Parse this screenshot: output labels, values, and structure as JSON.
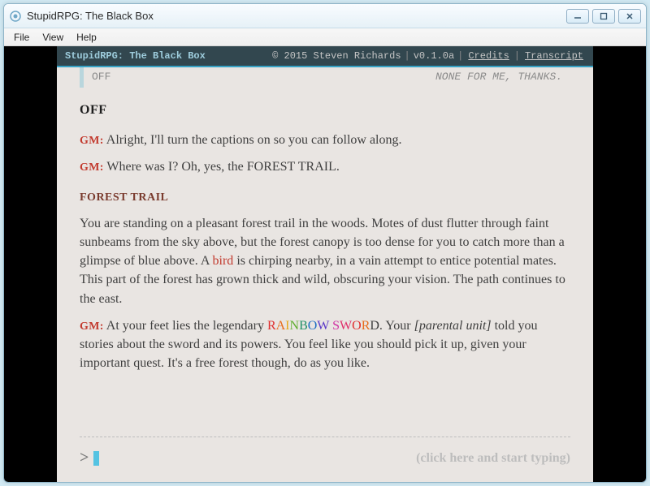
{
  "window": {
    "title": "StupidRPG: The Black Box",
    "menu": {
      "file": "File",
      "view": "View",
      "help": "Help"
    }
  },
  "gamebar": {
    "title": "StupidRPG: The Black Box",
    "copyright": "© 2015 Steven Richards",
    "version": "v0.1.0a",
    "credits": "Credits",
    "transcript": "Transcript"
  },
  "prev": {
    "left": "OFF",
    "right": "NONE FOR ME, THANKS."
  },
  "cmd": "OFF",
  "gm_label": "GM:",
  "gm1": " Alright, I'll turn the captions on so you can follow along.",
  "gm2": " Where was I? Oh, yes, the FOREST TRAIL.",
  "location": "FOREST TRAIL",
  "desc_a": "You are standing on a pleasant forest trail in the woods. Motes of dust flutter through faint sunbeams from the sky above, but the forest canopy is too dense for you to catch more than a glimpse of blue above. A ",
  "bird": "bird",
  "desc_b": " is chirping nearby, in a vain attempt to entice potential mates. This part of the forest has grown thick and wild, obscuring your vision. The path continues to the east.",
  "gm3_a": " At your feet lies the legendary ",
  "rainbow": "RAINBOW SWORD",
  "gm3_b": ". Your ",
  "parental": "[parental unit]",
  "gm3_c": " told you stories about the sword and its powers. You feel like you should pick it up, given your important quest. It's a free forest though, do as you like.",
  "prompt": ">",
  "hint": "(click here and start typing)"
}
